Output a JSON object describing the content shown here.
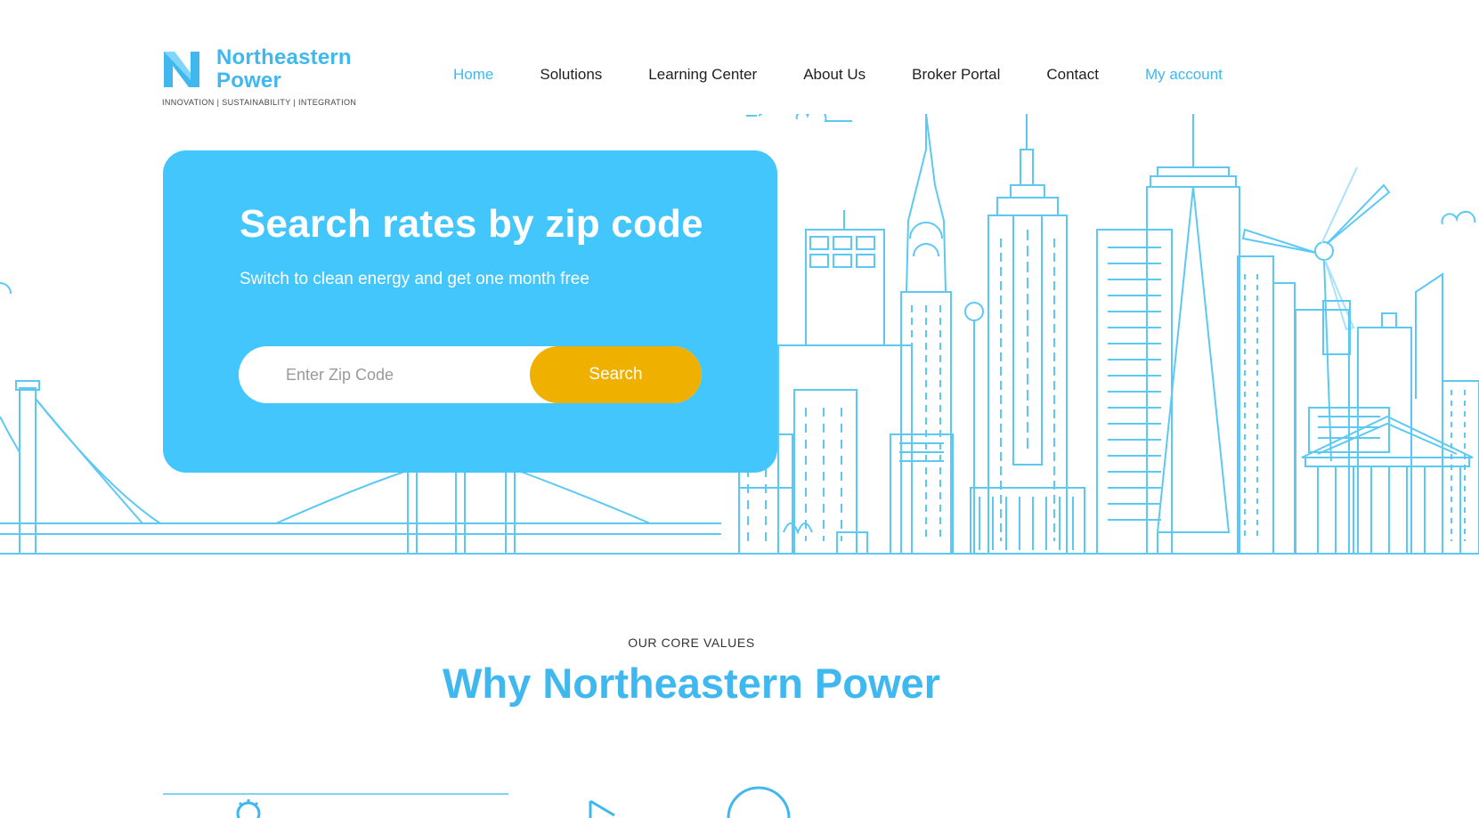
{
  "brand": {
    "name_line1": "Northeastern",
    "name_line2": "Power",
    "tagline": "INNOVATION | SUSTAINABILITY | INTEGRATION",
    "logo_icon": "n-logo-icon",
    "color": "#3fb8ef"
  },
  "nav": {
    "items": [
      {
        "label": "Home",
        "active": true
      },
      {
        "label": "Solutions"
      },
      {
        "label": "Learning Center"
      },
      {
        "label": "About Us"
      },
      {
        "label": "Broker Portal"
      },
      {
        "label": "Contact"
      }
    ],
    "account_label": "My account"
  },
  "hero": {
    "title": "Search rates by zip code",
    "subtitle": "Switch to clean energy and get one month free",
    "zip_placeholder": "Enter Zip Code",
    "zip_value": "",
    "search_label": "Search",
    "card_color": "#42c6fb",
    "button_color": "#f0b000",
    "illustration": "city-skyline-line-art"
  },
  "core_values": {
    "eyebrow": "OUR CORE VALUES",
    "title": "Why Northeastern Power",
    "icons": [
      "gear-icon",
      "play-icon",
      "circle-icon"
    ]
  }
}
